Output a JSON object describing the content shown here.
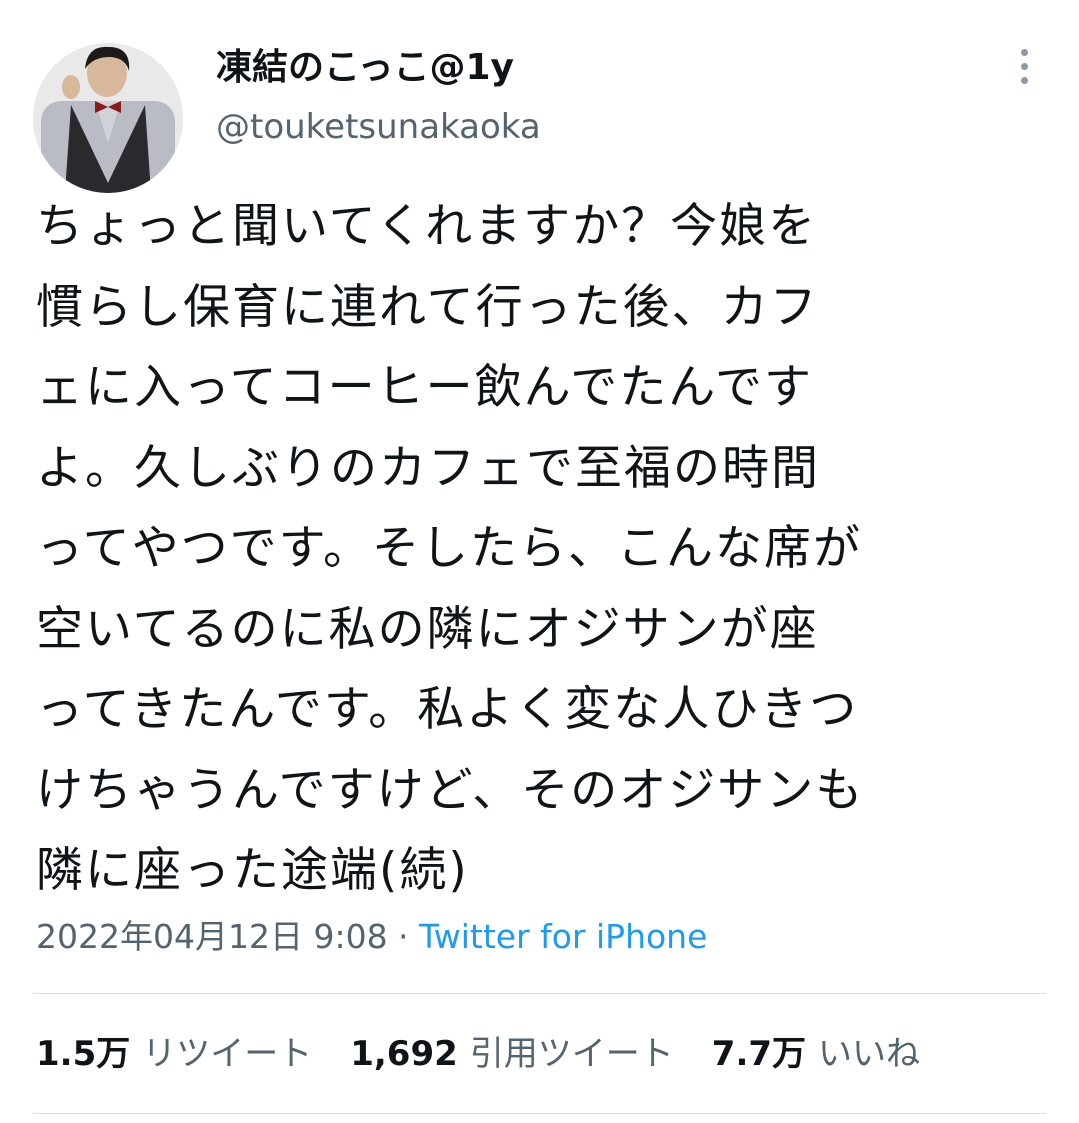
{
  "user": {
    "display_name": "凍結のこっこ@1y",
    "handle": "@touketsunakaoka",
    "avatar_icon": "person-photo-avatar"
  },
  "tweet": {
    "lines": [
      "ちょっと聞いてくれますか？今娘を",
      "慣らし保育に連れて行った後、カフ",
      "ェに入ってコーヒー飲んでたんです",
      "よ。久しぶりのカフェで至福の時間",
      "ってやつです。そしたら、こんな席が",
      "空いてるのに私の隣にオジサンが座",
      "ってきたんです。私よく変な人ひきつ",
      "けちゃうんですけど、そのオジサンも",
      "隣に座った途端(続)"
    ],
    "datetime": "2022年04月12日 9:08",
    "separator": " · ",
    "source": "Twitter for iPhone"
  },
  "stats": [
    {
      "value": "1.5万",
      "label": "リツイート"
    },
    {
      "value": "1,692",
      "label": "引用ツイート"
    },
    {
      "value": "7.7万",
      "label": "いいね"
    }
  ],
  "colors": {
    "text": "#0f1419",
    "secondary": "#536471",
    "link": "#1d9bf0",
    "divider": "#d9dee2"
  }
}
